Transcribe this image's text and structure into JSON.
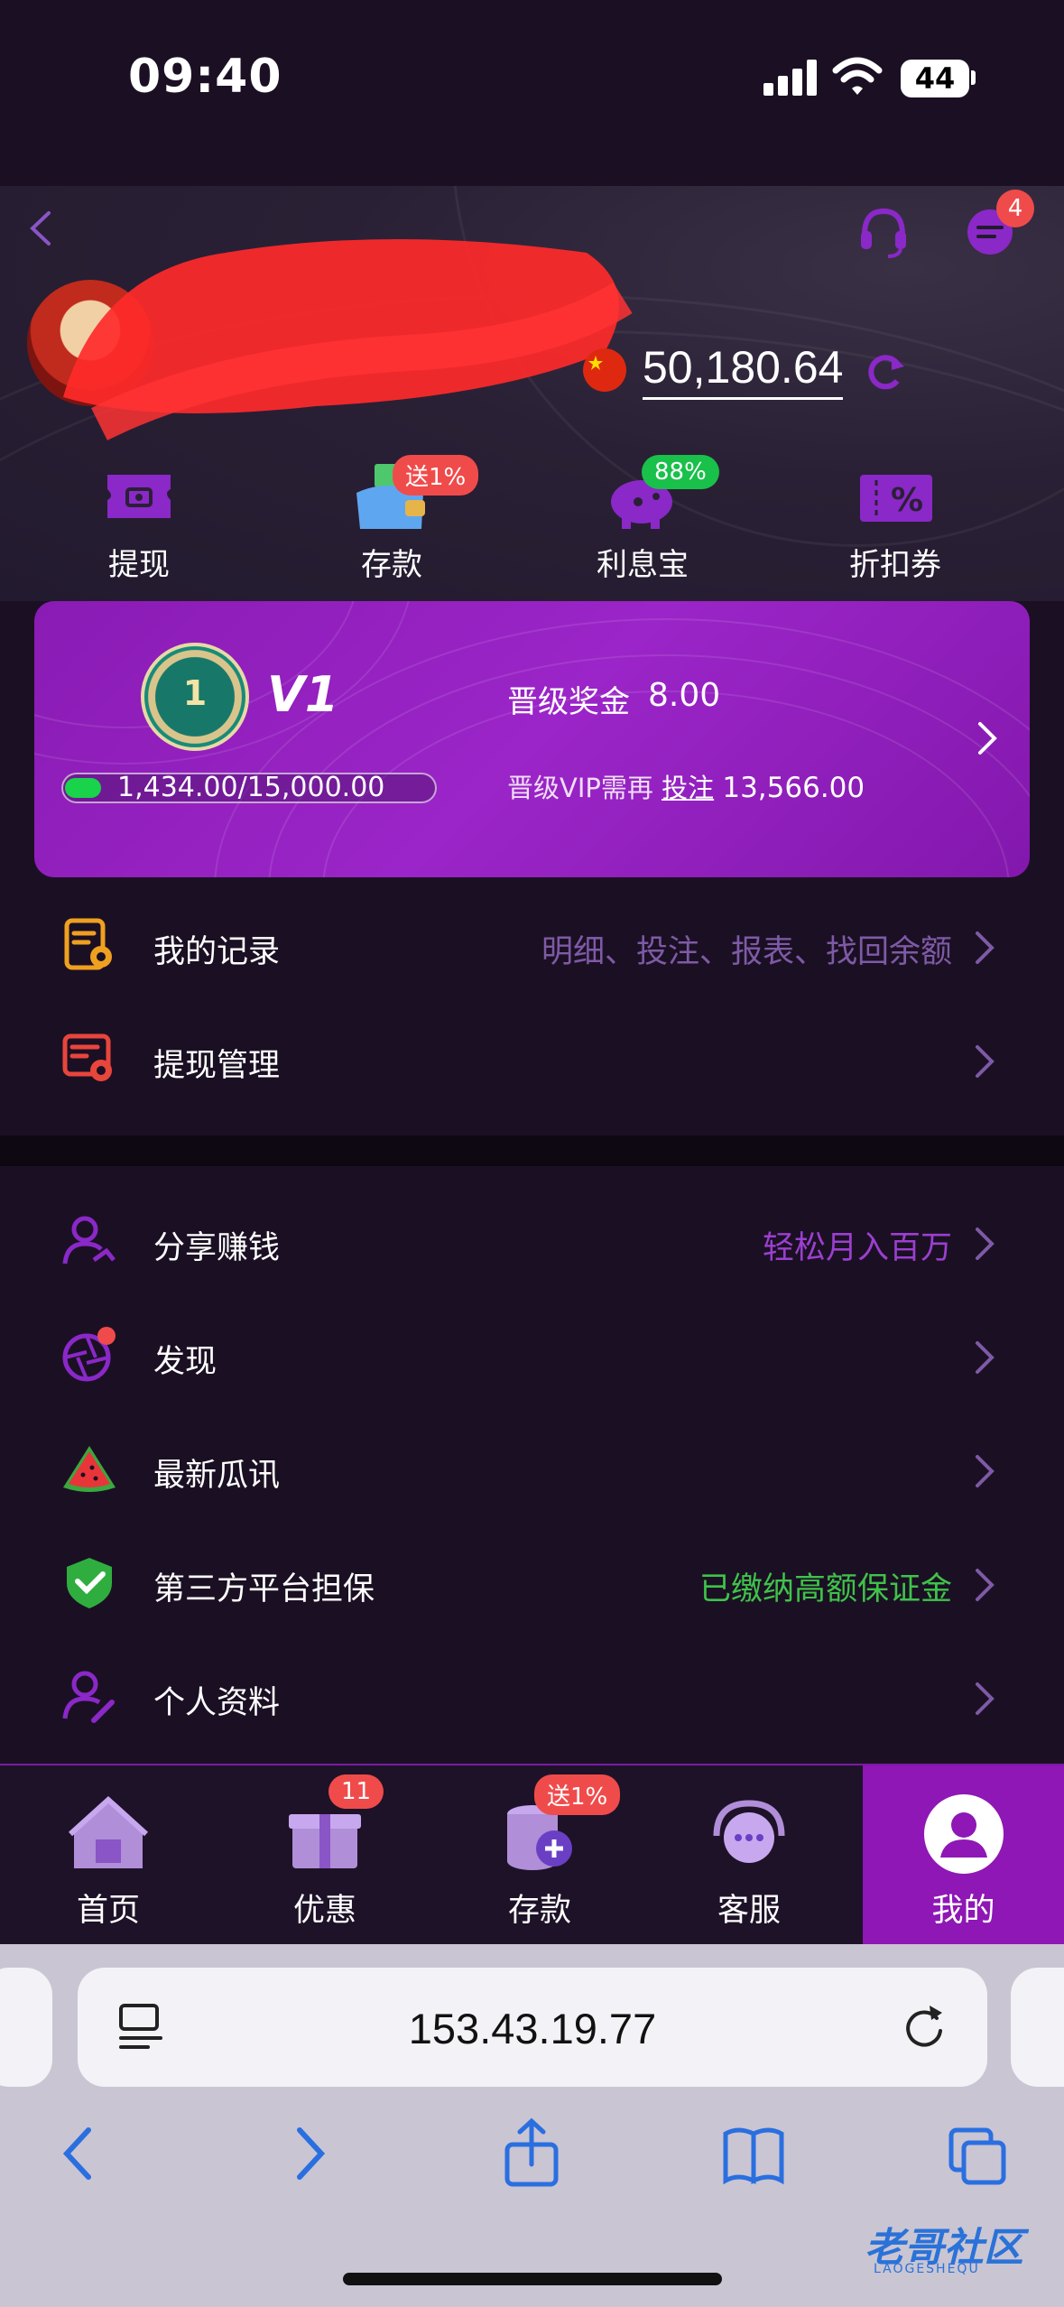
{
  "status_bar": {
    "time": "09:40",
    "battery": "44"
  },
  "header": {
    "balance": "50,180.64",
    "message_badge": "4"
  },
  "quick_actions": [
    {
      "label": "提现",
      "icon": "withdraw-ticket-icon"
    },
    {
      "label": "存款",
      "icon": "deposit-wallet-icon",
      "badge": "送1%"
    },
    {
      "label": "利息宝",
      "icon": "piggy-bank-icon",
      "badge": "88%"
    },
    {
      "label": "折扣券",
      "icon": "discount-coupon-icon"
    }
  ],
  "vip": {
    "level": "V1",
    "medal_number": "1",
    "bonus_label": "晋级奖金",
    "bonus_value": "8.00",
    "progress_text": "1,434.00/15,000.00",
    "progress_fraction": 0.0956,
    "need_prefix": "晋级VIP需再",
    "need_link": "投注",
    "need_amount": "13,566.00"
  },
  "menu_group_1": [
    {
      "label": "我的记录",
      "hint": "明细、投注、报表、找回余额",
      "hint_color": "#7e5aa6"
    },
    {
      "label": "提现管理",
      "hint": ""
    }
  ],
  "menu_group_2": [
    {
      "label": "分享赚钱",
      "hint": "轻松月入百万",
      "hint_color": "#9b3fd0"
    },
    {
      "label": "发现",
      "hint": ""
    },
    {
      "label": "最新瓜讯",
      "hint": ""
    },
    {
      "label": "第三方平台担保",
      "hint": "已缴纳高额保证金",
      "hint_color": "#3fc24a"
    },
    {
      "label": "个人资料",
      "hint": ""
    }
  ],
  "tabs": [
    {
      "label": "首页"
    },
    {
      "label": "优惠",
      "badge": "11"
    },
    {
      "label": "存款",
      "badge": "送1%"
    },
    {
      "label": "客服"
    },
    {
      "label": "我的",
      "active": true
    }
  ],
  "browser": {
    "url": "153.43.19.77"
  },
  "watermark": {
    "text": "老哥社区",
    "sub": "LAOGESHEQU"
  },
  "colors": {
    "accent": "#8e17b5",
    "badge_red": "#f04b4b",
    "badge_green": "#19c04a"
  }
}
